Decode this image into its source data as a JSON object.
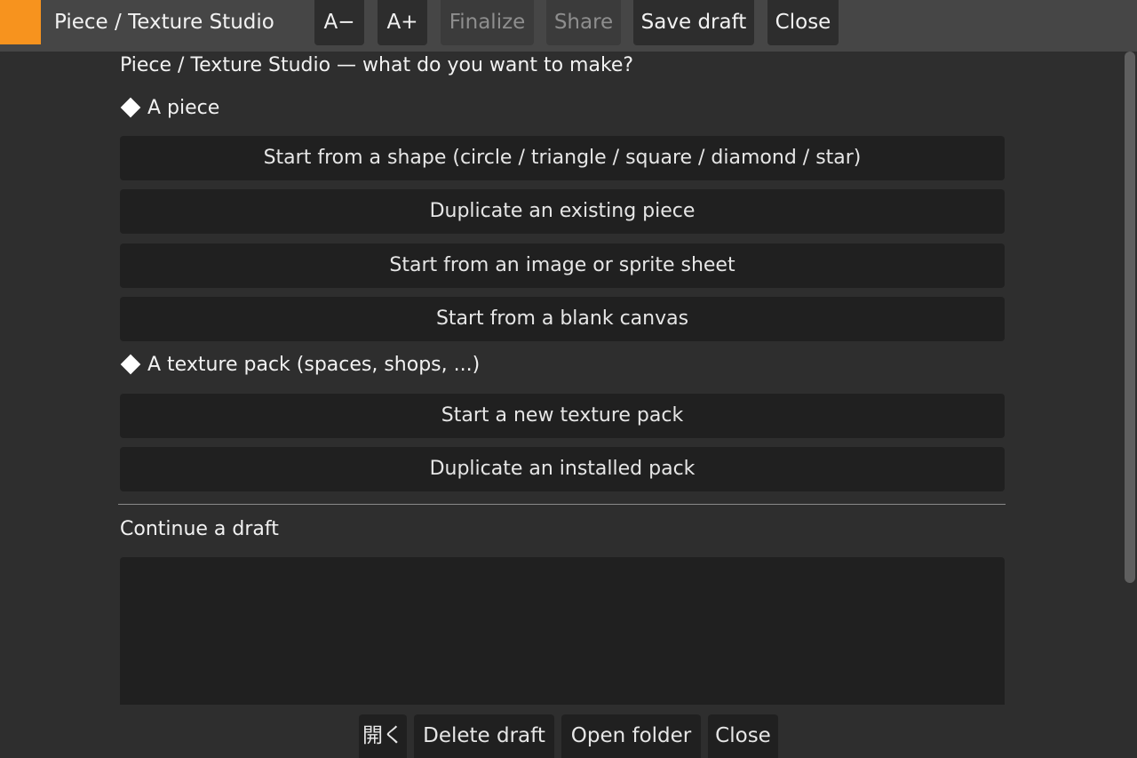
{
  "titlebar": {
    "title": "Piece / Texture Studio",
    "accent_color": "#f7931e",
    "buttons": [
      {
        "label": "A−",
        "enabled": true
      },
      {
        "label": "A+",
        "enabled": true
      },
      {
        "label": "Finalize",
        "enabled": false
      },
      {
        "label": "Share",
        "enabled": false
      },
      {
        "label": "Save draft",
        "enabled": true
      },
      {
        "label": "Close",
        "enabled": true
      }
    ]
  },
  "main": {
    "heading": "Piece / Texture Studio — what do you want to make?",
    "piece_section": {
      "title": "A piece",
      "options": [
        "Start from a shape (circle / triangle / square / diamond / star)",
        "Duplicate an existing piece",
        "Start from an image or sprite sheet",
        "Start from a blank canvas"
      ]
    },
    "texture_section": {
      "title": "A texture pack (spaces, shops, ...)",
      "options": [
        "Start a new texture pack",
        "Duplicate an installed pack"
      ]
    },
    "drafts": {
      "title": "Continue a draft",
      "items": []
    }
  },
  "footer": {
    "buttons": [
      "開く",
      "Delete draft",
      "Open folder",
      "Close"
    ]
  }
}
